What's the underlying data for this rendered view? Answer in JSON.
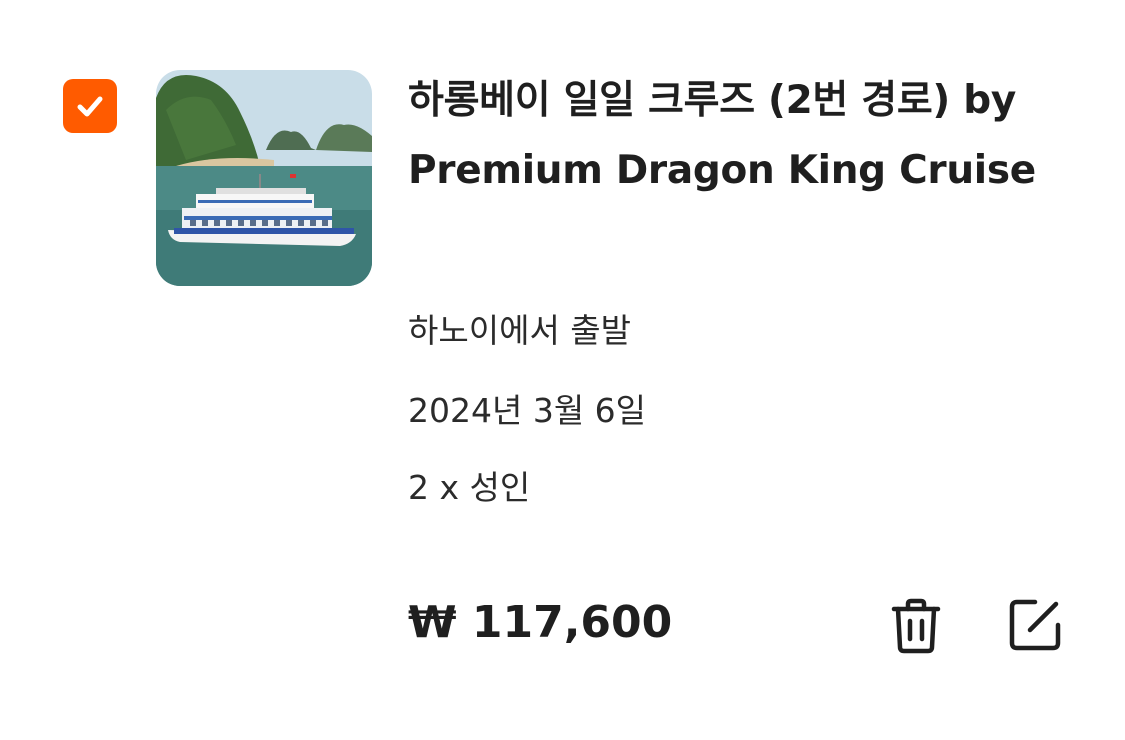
{
  "cart_item": {
    "selected": true,
    "title": "하롱베이 일일 크루즈 (2번 경로) by Premium Dragon King Cruise",
    "departure": "하노이에서 출발",
    "date": "2024년 3월 6일",
    "guests": "2 x 성인",
    "price": "₩ 117,600",
    "thumbnail_icon": "cruise-ship-photo",
    "colors": {
      "checkbox": "#ff5b00",
      "text": "#1f1f1f"
    },
    "actions": {
      "delete_icon": "trash-icon",
      "edit_icon": "edit-icon"
    }
  }
}
